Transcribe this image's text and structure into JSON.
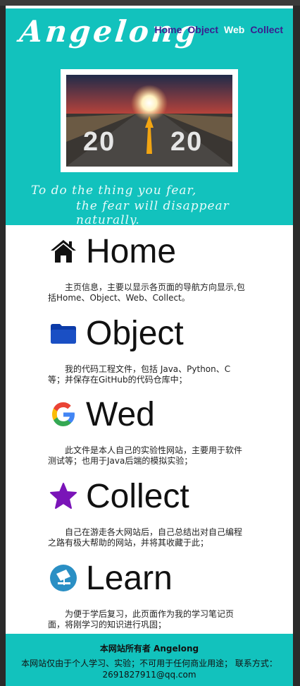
{
  "header": {
    "logo": "Angelong",
    "nav": [
      "Home",
      "Object",
      "Web",
      "Collect"
    ],
    "active_nav": "Web",
    "banner": {
      "year_left": "20",
      "year_right": "20"
    },
    "slogan_line1": "To do the thing you fear,",
    "slogan_line2": "the fear will disappear naturally."
  },
  "sections": [
    {
      "icon": "home-icon",
      "title": "Home",
      "desc": "主页信息，主要以显示各页面的导航方向显示,包括Home、Object、Web、Collect。"
    },
    {
      "icon": "folder-icon",
      "title": "Object",
      "desc": "我的代码工程文件，包括 Java、Python、C 等；并保存在GitHub的代码仓库中；"
    },
    {
      "icon": "google-icon",
      "title": "Wed",
      "desc": "此文件是本人自己的实验性网站，主要用于软件测试等；也用于Java后端的模拟实验；"
    },
    {
      "icon": "star-icon",
      "title": "Collect",
      "desc": "自己在游走各大网站后，自己总结出对自己编程之路有极大帮助的网站，并将其收藏于此；"
    },
    {
      "icon": "learn-icon",
      "title": "Learn",
      "desc": "为便于学后复习，此页面作为我的学习笔记页面，将刚学习的知识进行巩固；"
    }
  ],
  "footer": {
    "owner": "本网站所有者 Angelong",
    "note": "本网站仅由于个人学习、实验；不可用于任何商业用途； 联系方式：2691827911@qq.com"
  }
}
